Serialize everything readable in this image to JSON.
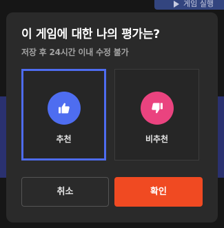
{
  "background": {
    "top_button_label": "게임 실행"
  },
  "dialog": {
    "title": "이 게임에 대한 나의 평가는?",
    "subtitle": "저장 후 24시간 이내 수정 불가",
    "options": [
      {
        "label": "추천",
        "icon": "thumbs-up-icon",
        "color": "#4e6df0",
        "selected": true
      },
      {
        "label": "비추천",
        "icon": "thumbs-down-icon",
        "color": "#ea437f",
        "selected": false
      }
    ],
    "cancel_label": "취소",
    "confirm_label": "확인",
    "accent_color": "#f04a22",
    "selection_color": "#4e6cf0"
  }
}
